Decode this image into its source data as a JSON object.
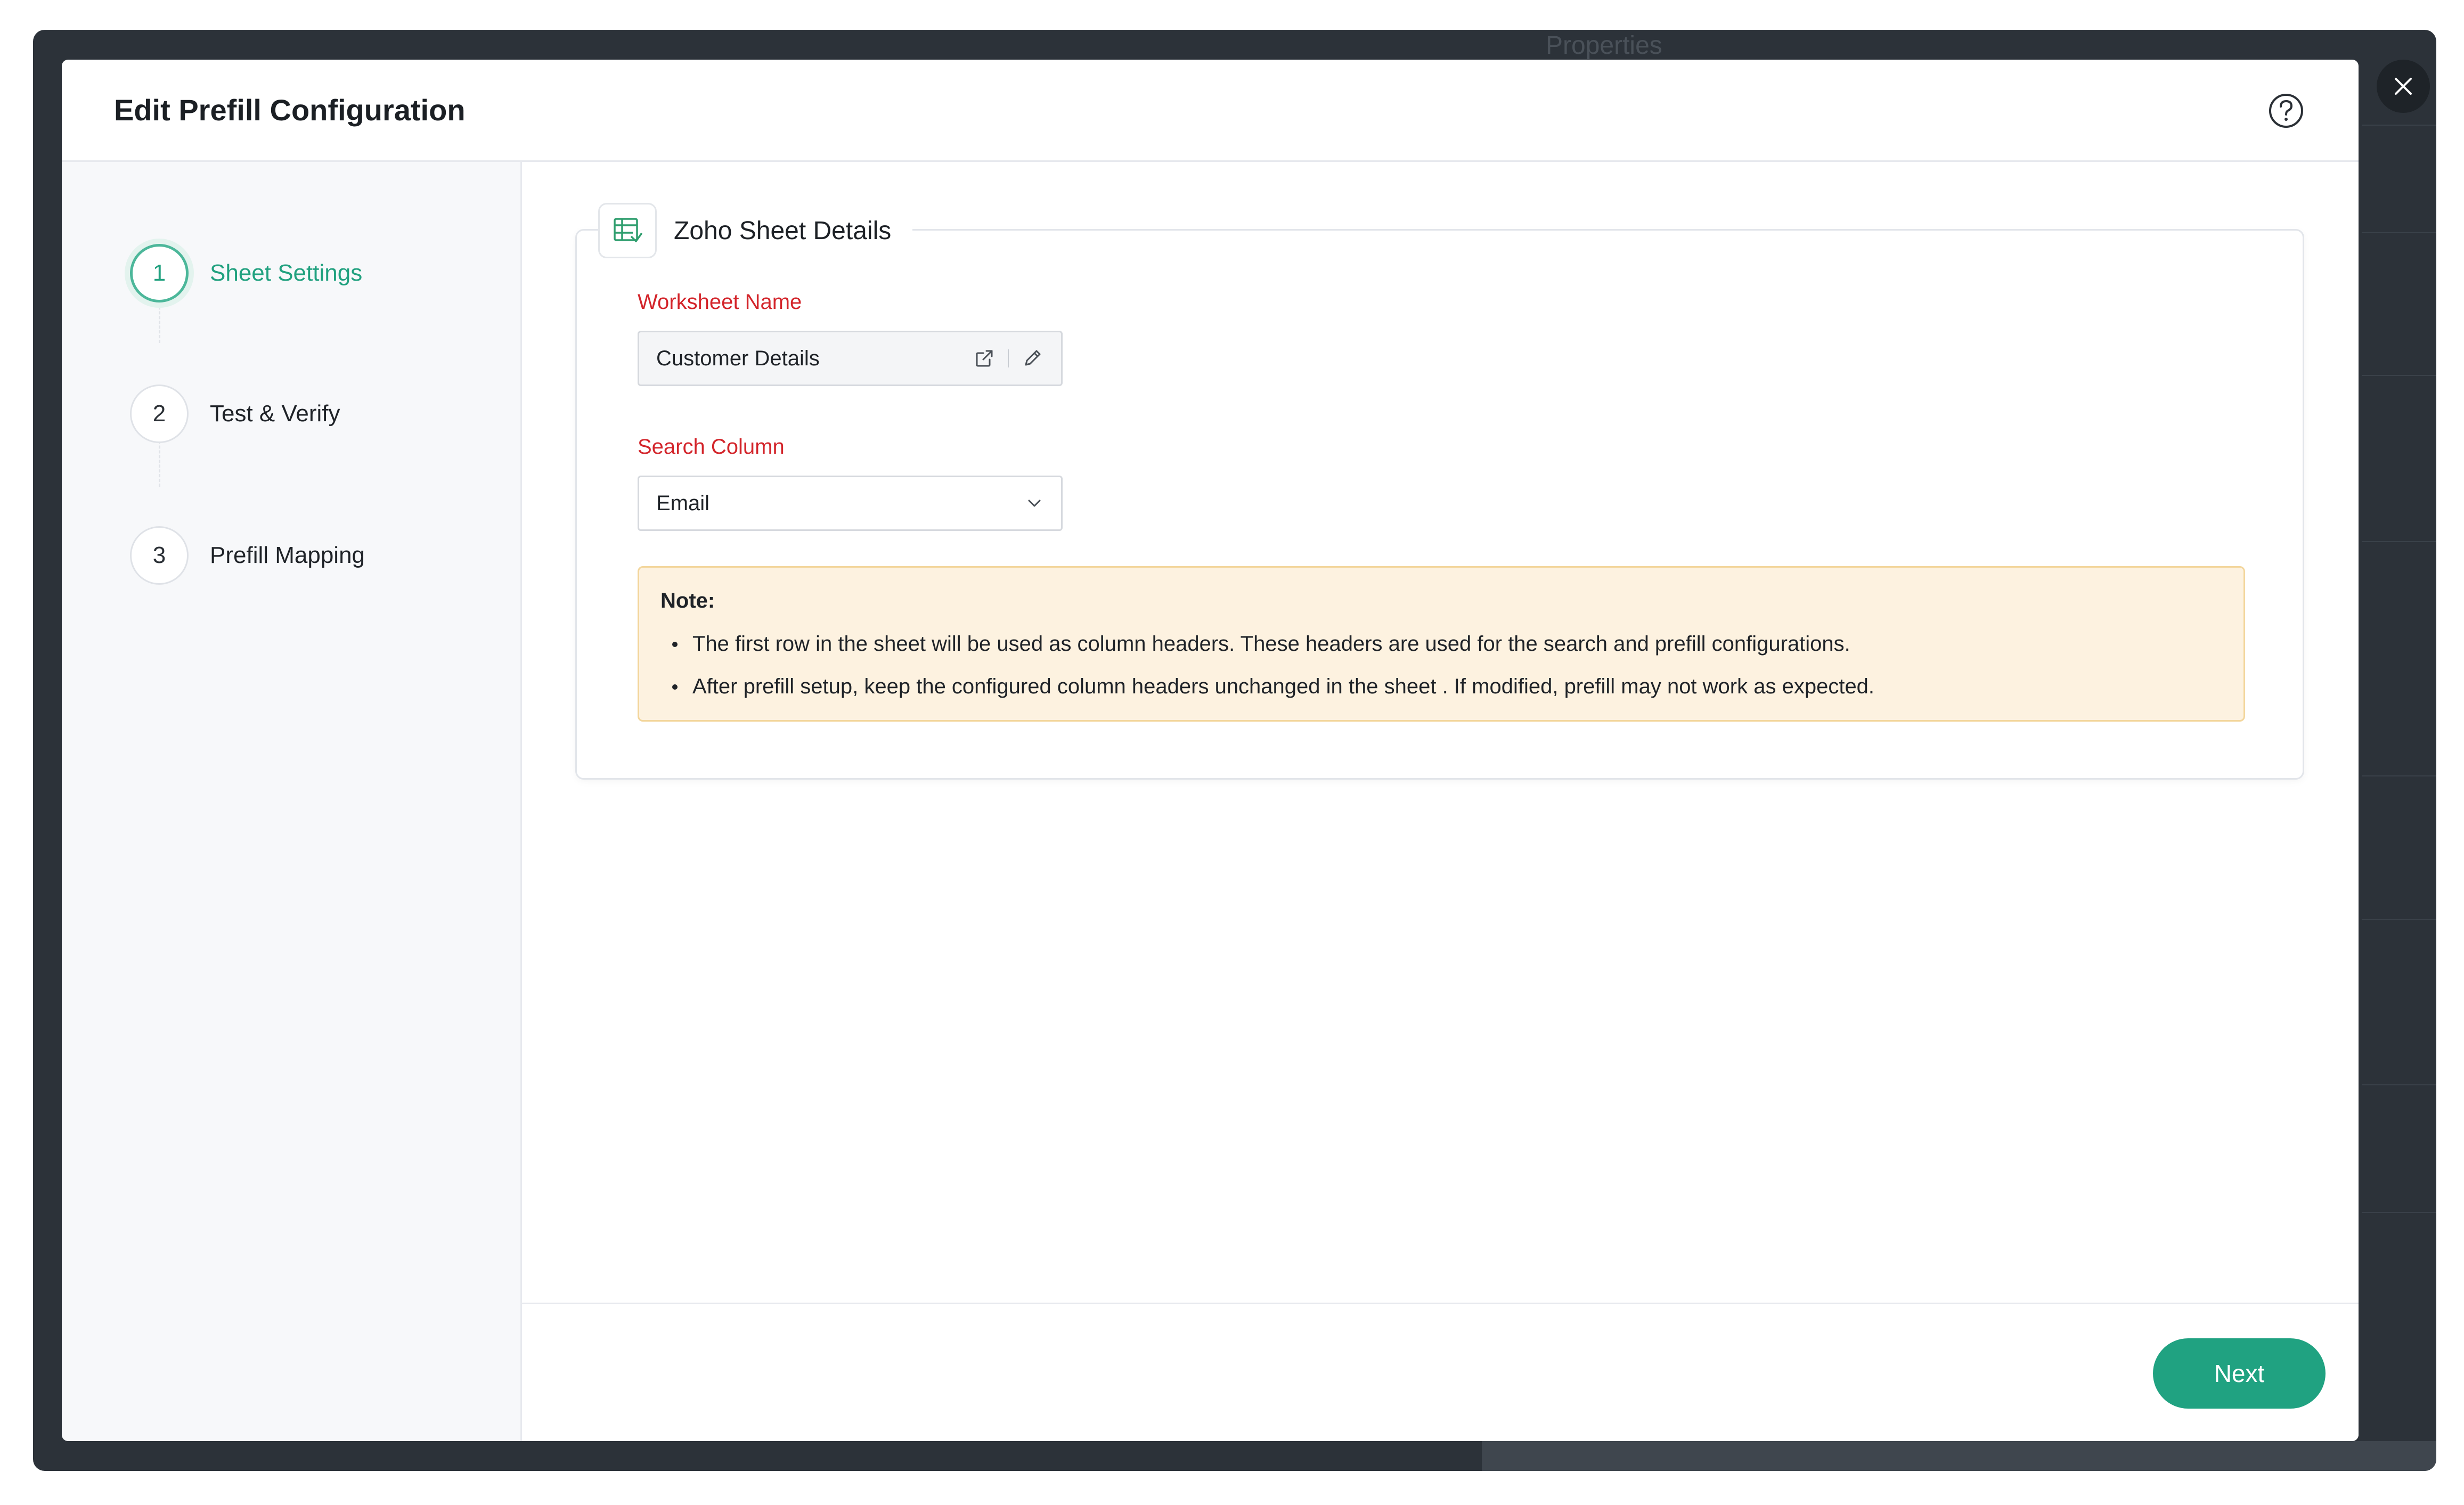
{
  "background": {
    "panel_title": "Properties"
  },
  "modal": {
    "title": "Edit Prefill Configuration"
  },
  "steps": [
    {
      "number": "1",
      "label": "Sheet Settings"
    },
    {
      "number": "2",
      "label": "Test & Verify"
    },
    {
      "number": "3",
      "label": "Prefill Mapping"
    }
  ],
  "card": {
    "title": "Zoho Sheet Details",
    "worksheet": {
      "label": "Worksheet Name",
      "value": "Customer Details"
    },
    "search_column": {
      "label": "Search Column",
      "value": "Email"
    },
    "note": {
      "title": "Note:",
      "items": [
        "The first row in the sheet will be used as column headers. These headers are used for the search and prefill configurations.",
        "After prefill setup, keep the configured column headers unchanged in the sheet . If modified, prefill may not work as expected."
      ]
    }
  },
  "footer": {
    "next_label": "Next"
  },
  "colors": {
    "accent": "#20a281",
    "required_label": "#d3242a",
    "note_background": "#fdf2e0",
    "note_border": "#f3d69c"
  },
  "icons": {
    "close": "close-icon",
    "help": "help-icon",
    "sheet": "spreadsheet-icon",
    "open_external": "external-link-icon",
    "edit": "pencil-icon",
    "dropdown": "chevron-down-icon"
  }
}
